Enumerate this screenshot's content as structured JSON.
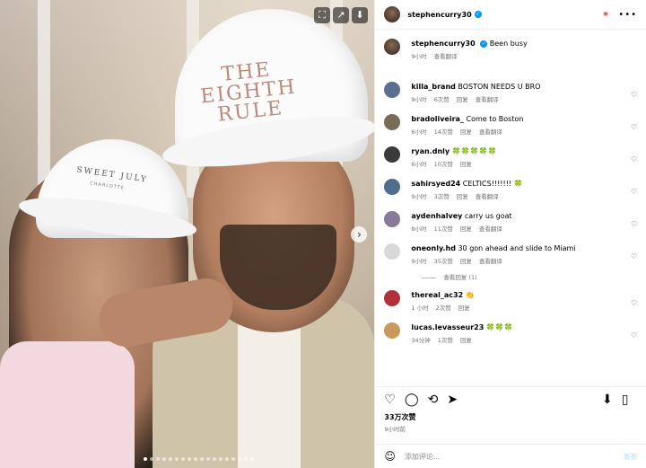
{
  "post": {
    "username": "stephencurry30",
    "verified_mark": "✓",
    "caption": "Been busy",
    "caption_time": "9小时",
    "caption_translate": "查看翻译",
    "likes": "33万次赞",
    "time": "9小时前",
    "comment_placeholder": "添加评论...",
    "post_button": "发布",
    "hat_text_left": "SWEET JULY",
    "hat_text_left_sub": "CHARLOTTE",
    "hat_text_right": "THE EIGHTH RULE"
  },
  "comments": [
    {
      "user": "killa_brand",
      "text": "BOSTON NEEDS U BRO",
      "time": "9小时",
      "likes": "6次赞",
      "reply": "回复",
      "translate": "查看翻译"
    },
    {
      "user": "bradoliveira_",
      "text": "Come to Boston",
      "time": "6小时",
      "likes": "14次赞",
      "reply": "回复",
      "translate": "查看翻译"
    },
    {
      "user": "ryan.dnly",
      "text": "🍀🍀🍀🍀🍀",
      "time": "6小时",
      "likes": "10次赞",
      "reply": "回复",
      "translate": ""
    },
    {
      "user": "sahirsyed24",
      "text": "CELTICS!!!!!!! 🍀",
      "time": "9小时",
      "likes": "3次赞",
      "reply": "回复",
      "translate": "查看翻译"
    },
    {
      "user": "aydenhalvey",
      "text": "carry us goat",
      "time": "8小时",
      "likes": "11次赞",
      "reply": "回复",
      "translate": "查看翻译"
    },
    {
      "user": "oneonly.hd",
      "text": "30 gon ahead and slide to Miami",
      "time": "9小时",
      "likes": "35次赞",
      "reply": "回复",
      "translate": "查看翻译",
      "view_replies": "查看回复 (1)"
    },
    {
      "user": "thereal_ac32",
      "text": "👏",
      "time": "1 小时",
      "likes": "2次赞",
      "reply": "回复",
      "translate": ""
    },
    {
      "user": "lucas.levasseur23",
      "text": "🍀🍀🍀",
      "time": "34分钟",
      "likes": "1次赞",
      "reply": "回复",
      "translate": ""
    }
  ],
  "colors": {
    "verified": "#0095f6",
    "meta": "#737373",
    "post": "#b3dbff"
  }
}
